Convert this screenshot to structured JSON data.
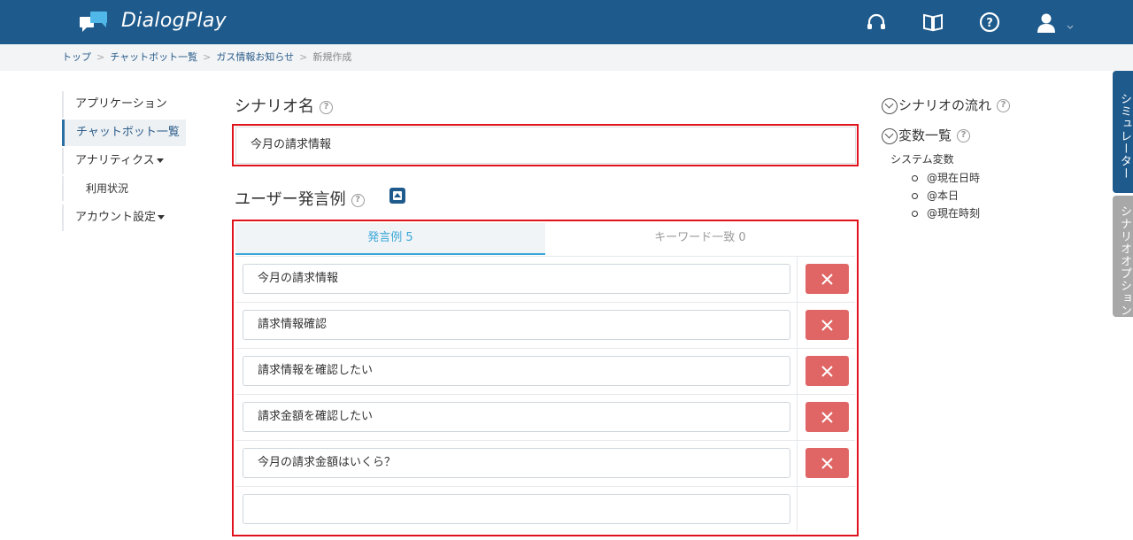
{
  "header": {
    "brand": "DialogPlay",
    "icons": [
      "headset-icon",
      "book-icon",
      "help-icon",
      "user-icon"
    ]
  },
  "breadcrumb": {
    "items": [
      "トップ",
      "チャットボット一覧",
      "ガス情報お知らせ"
    ],
    "current": "新規作成"
  },
  "sidebar": {
    "items": [
      {
        "label": "アプリケーション"
      },
      {
        "label": "チャットボット一覧"
      },
      {
        "label": "アナリティクス"
      },
      {
        "label": "利用状況"
      },
      {
        "label": "アカウント設定"
      }
    ]
  },
  "scenario": {
    "title": "シナリオ名",
    "value": "今月の請求情報"
  },
  "utterances": {
    "title": "ユーザー発言例",
    "tabs": [
      {
        "label": "発言例 5"
      },
      {
        "label": "キーワード一致 0"
      }
    ],
    "rows": [
      {
        "value": "今月の請求情報"
      },
      {
        "value": "請求情報確認"
      },
      {
        "value": "請求情報を確認したい"
      },
      {
        "value": "請求金額を確認したい"
      },
      {
        "value": "今月の請求金額はいくら？"
      }
    ],
    "new_value": ""
  },
  "right_panel": {
    "flow_title": "シナリオの流れ",
    "vars_title": "変数一覧",
    "system_vars_label": "システム変数",
    "system_vars": [
      "@現在日時",
      "@本日",
      "@現在時刻"
    ]
  },
  "side_tabs": {
    "simulator": "シミュレーター",
    "options": "シナリオオプション"
  },
  "colors": {
    "header": "#1e5a8c",
    "highlight": "#e0121b",
    "delete": "#e06666",
    "tab_active": "#3aa7d8"
  }
}
